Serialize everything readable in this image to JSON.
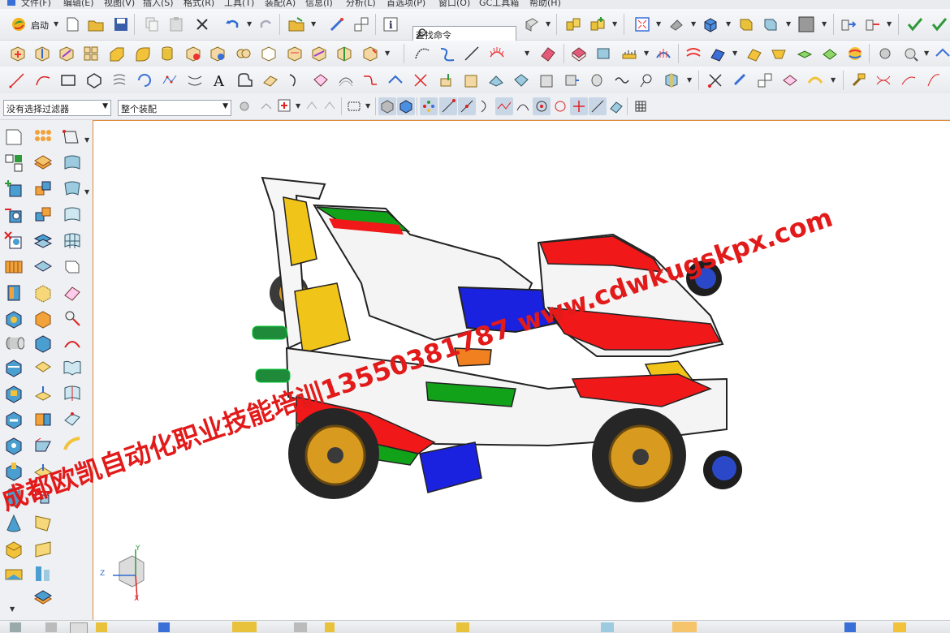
{
  "menu": {
    "items": [
      "文件(F)",
      "编辑(E)",
      "视图(V)",
      "插入(S)",
      "格式(R)",
      "工具(T)",
      "装配(A)",
      "信息(I)",
      "分析(L)",
      "首选项(P)",
      "窗口(O)",
      "GC工具箱",
      "帮助(H)"
    ]
  },
  "toolbar": {
    "start_label": "启动",
    "search_placeholder": "查找命令"
  },
  "filterbar": {
    "selection_filter": "没有选择过滤器",
    "assembly_scope": "整个装配"
  },
  "triad": {
    "x_label": "X",
    "y_label": "Y",
    "z_label": "Z"
  },
  "watermark": {
    "line1": "成都欧凯自动化职业技能培训13550381787 www.cdwkugskpx.com"
  },
  "colors": {
    "viewport_border": "#e08a3c",
    "watermark": "#e21a1a",
    "car_red": "#f01818",
    "car_green": "#12a21a",
    "car_blue": "#1a22e0",
    "car_yellow": "#f0c418",
    "car_orange": "#f08020",
    "wheel_gold": "#d99a20"
  }
}
